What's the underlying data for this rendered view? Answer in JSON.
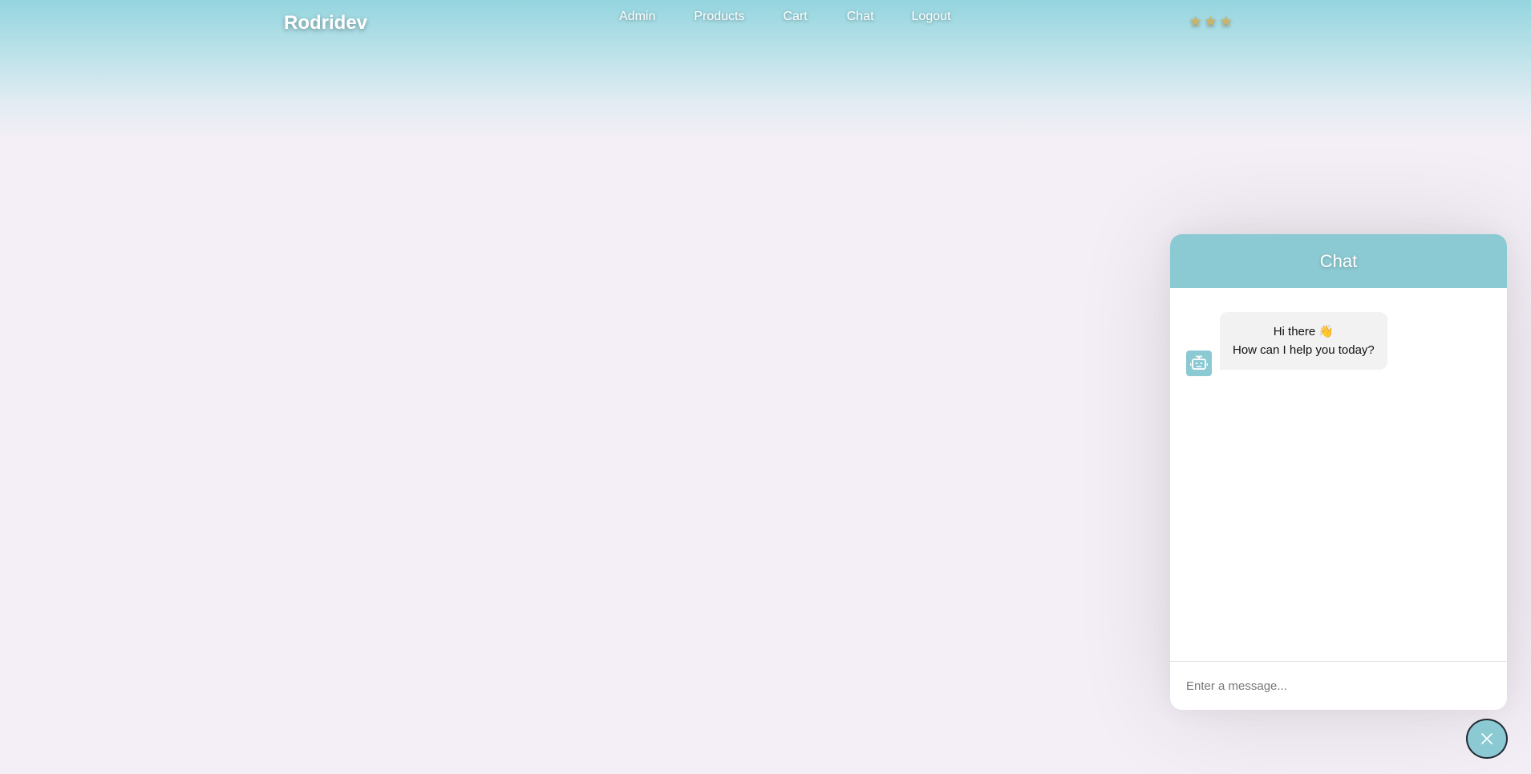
{
  "header": {
    "brand": "Rodridev",
    "nav": [
      "Admin",
      "Products",
      "Cart",
      "Chat",
      "Logout"
    ],
    "rating_stars": 3
  },
  "chat": {
    "title": "Chat",
    "messages": [
      {
        "sender": "bot",
        "line1": "Hi there 👋",
        "line2": "How can I help you today?"
      }
    ],
    "input_placeholder": "Enter a message...",
    "close_icon": "close-icon",
    "bot_icon": "robot-icon"
  },
  "colors": {
    "accent": "#8ccad3",
    "header_gradient_top": "#94d5df",
    "page_background": "#f4eff6",
    "bubble_background": "#f2f2f2"
  }
}
